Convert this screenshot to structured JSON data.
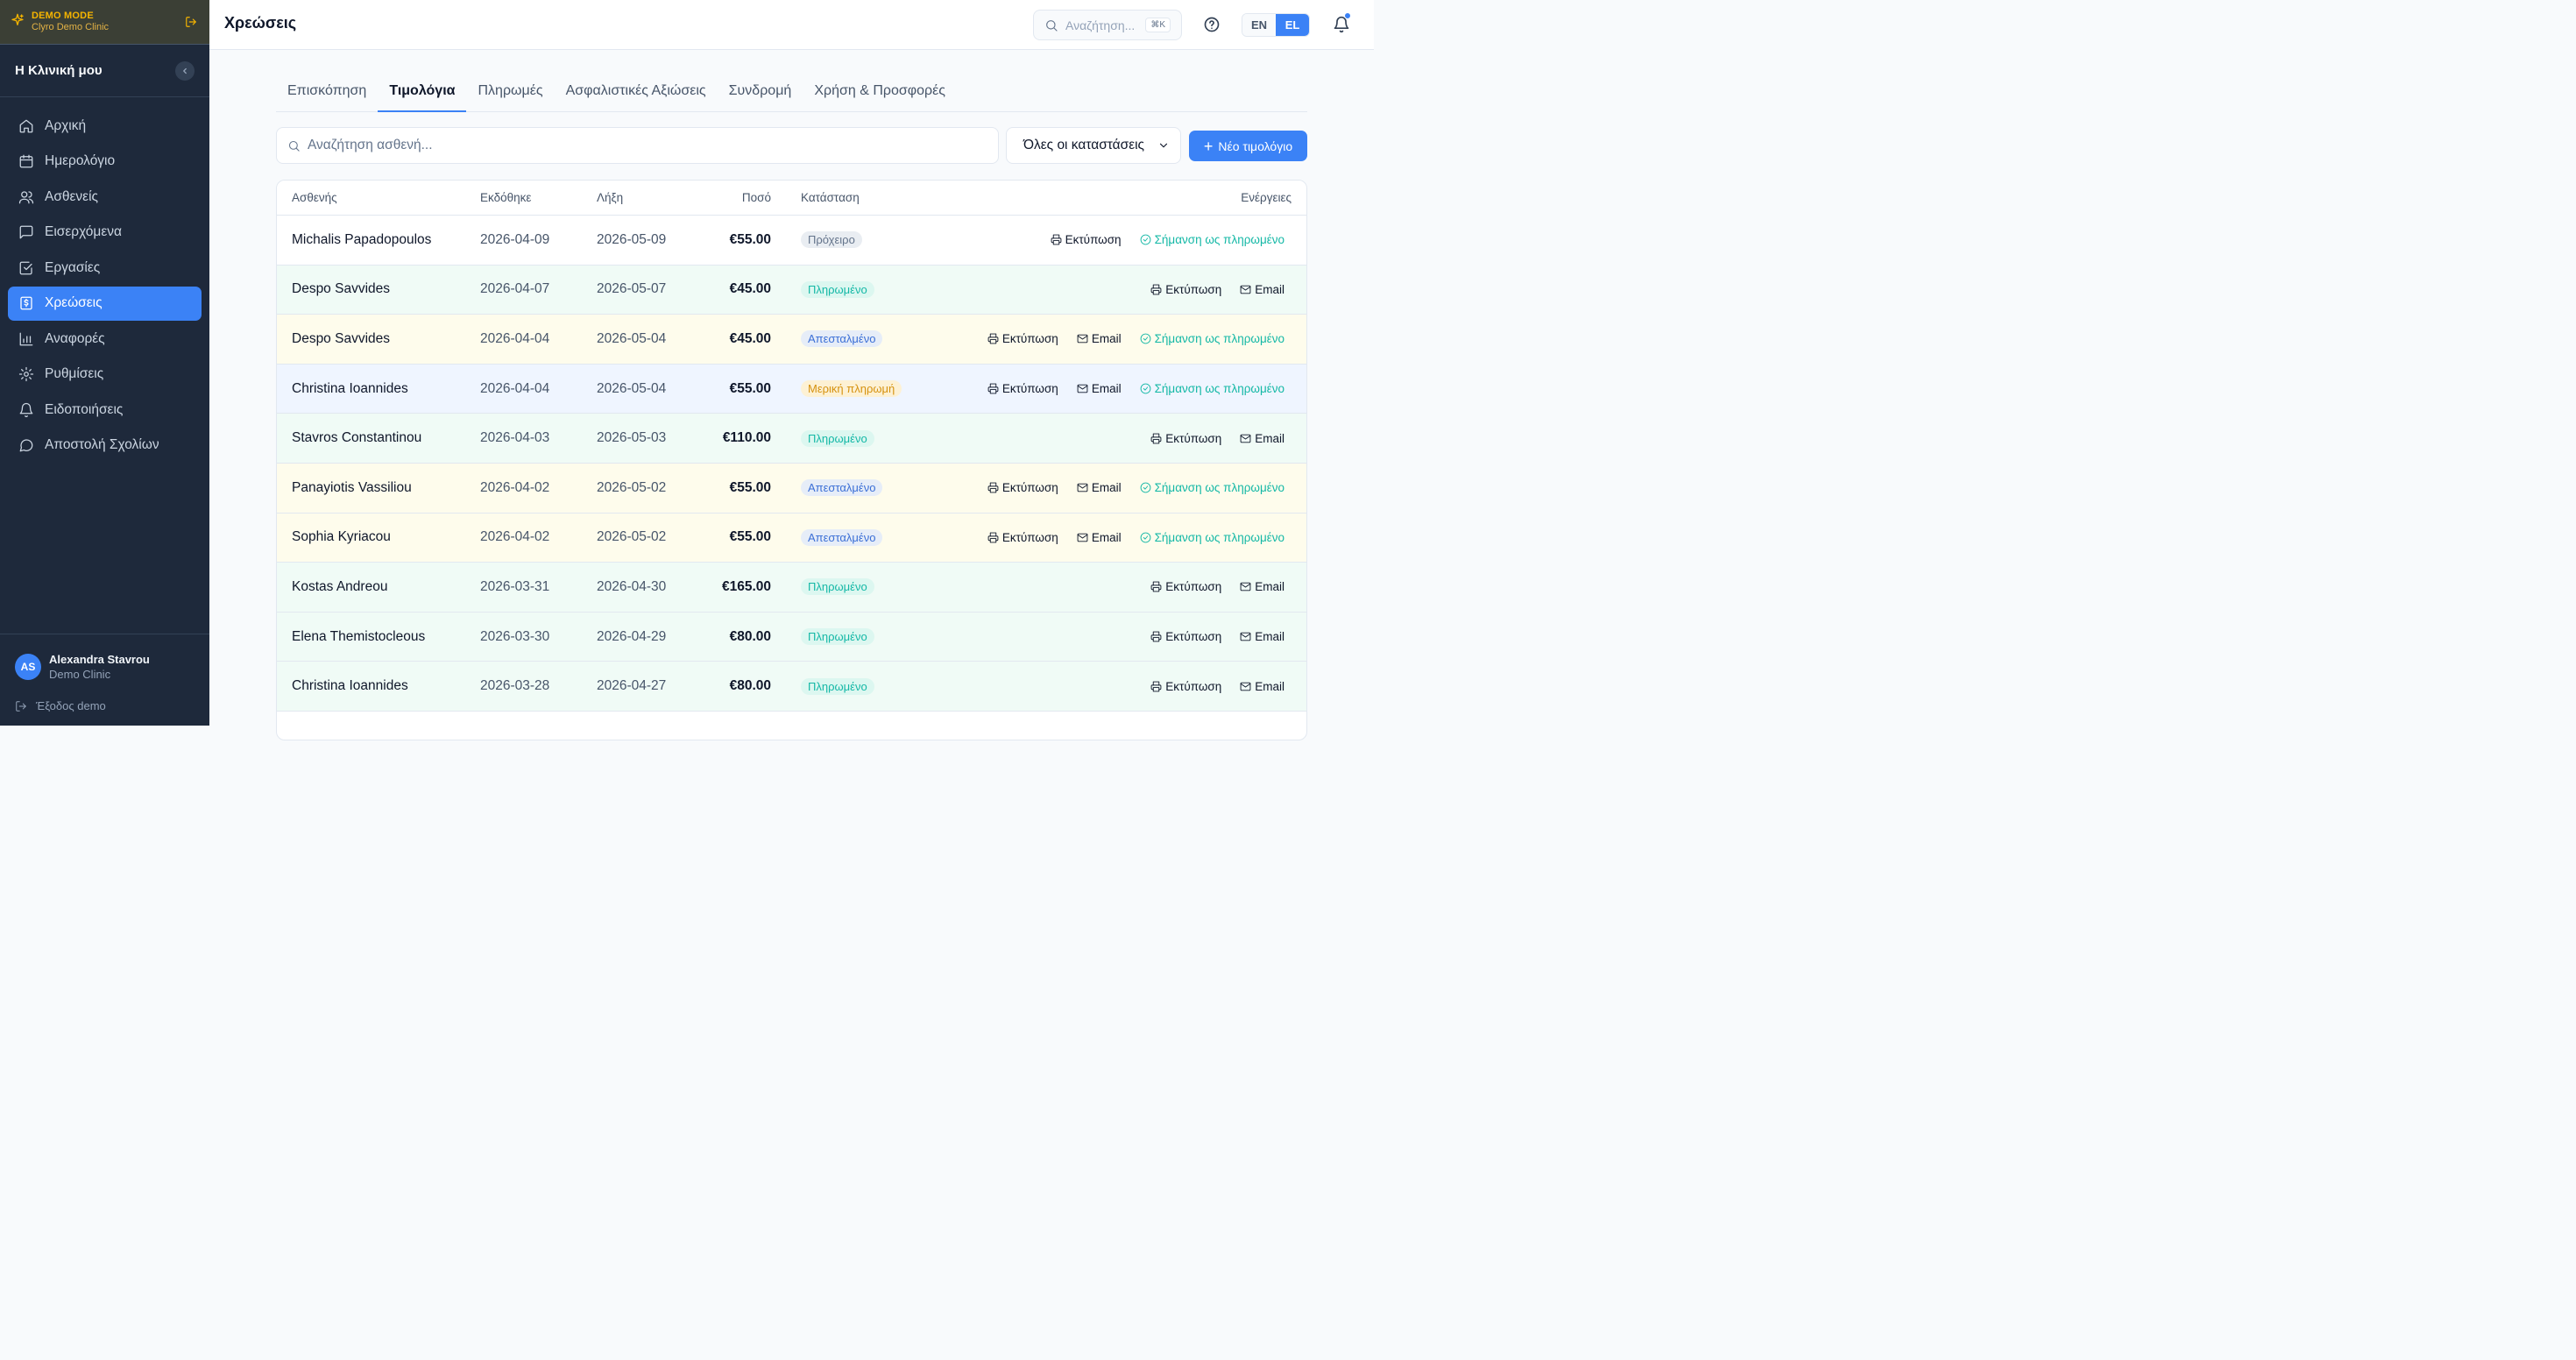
{
  "demo": {
    "mode_label": "DEMO MODE",
    "clinic": "Clyro Demo Clinic"
  },
  "sidebar": {
    "clinic_name": "Η Κλινική μου",
    "items": [
      {
        "label": "Αρχική",
        "icon": "home-icon"
      },
      {
        "label": "Ημερολόγιο",
        "icon": "calendar-icon"
      },
      {
        "label": "Ασθενείς",
        "icon": "users-icon"
      },
      {
        "label": "Εισερχόμενα",
        "icon": "inbox-icon"
      },
      {
        "label": "Εργασίες",
        "icon": "tasks-icon"
      },
      {
        "label": "Χρεώσεις",
        "icon": "billing-icon",
        "active": true
      },
      {
        "label": "Αναφορές",
        "icon": "chart-icon"
      },
      {
        "label": "Ρυθμίσεις",
        "icon": "gear-icon"
      },
      {
        "label": "Ειδοποιήσεις",
        "icon": "bell-icon"
      },
      {
        "label": "Αποστολή Σχολίων",
        "icon": "message-icon"
      }
    ],
    "user": {
      "initials": "AS",
      "name": "Alexandra Stavrou",
      "clinic": "Demo Clinic"
    },
    "logout_label": "Έξοδος demo"
  },
  "header": {
    "title": "Χρεώσεις",
    "search_placeholder": "Αναζήτηση...",
    "shortcut": "⌘K",
    "lang_en": "EN",
    "lang_el": "EL",
    "active_lang": "EL"
  },
  "tabs": [
    "Επισκόπηση",
    "Τιμολόγια",
    "Πληρωμές",
    "Ασφαλιστικές Αξιώσεις",
    "Συνδρομή",
    "Χρήση & Προσφορές"
  ],
  "active_tab": "Τιμολόγια",
  "toolbar": {
    "search_placeholder": "Αναζήτηση ασθενή...",
    "status_filter": "Όλες οι καταστάσεις",
    "new_invoice": "Νέο τιμολόγιο"
  },
  "table": {
    "columns": {
      "patient": "Ασθενής",
      "issued": "Εκδόθηκε",
      "due": "Λήξη",
      "amount": "Ποσό",
      "status": "Κατάσταση",
      "actions": "Ενέργειες"
    },
    "action_labels": {
      "print": "Εκτύπωση",
      "email": "Email",
      "mark_paid": "Σήμανση ως πληρωμένο"
    },
    "rows": [
      {
        "patient": "Michalis Papadopoulos",
        "issued": "2026-04-09",
        "due": "2026-05-09",
        "amount": "€55.00",
        "status": "Πρόχειρο",
        "kind": "draft",
        "actions": [
          "print",
          "mark_paid"
        ]
      },
      {
        "patient": "Despo Savvides",
        "issued": "2026-04-07",
        "due": "2026-05-07",
        "amount": "€45.00",
        "status": "Πληρωμένο",
        "kind": "paid",
        "actions": [
          "print",
          "email"
        ]
      },
      {
        "patient": "Despo Savvides",
        "issued": "2026-04-04",
        "due": "2026-05-04",
        "amount": "€45.00",
        "status": "Απεσταλμένο",
        "kind": "sent",
        "actions": [
          "print",
          "email",
          "mark_paid"
        ]
      },
      {
        "patient": "Christina Ioannides",
        "issued": "2026-04-04",
        "due": "2026-05-04",
        "amount": "€55.00",
        "status": "Μερική πληρωμή",
        "kind": "partial",
        "actions": [
          "print",
          "email",
          "mark_paid"
        ]
      },
      {
        "patient": "Stavros Constantinou",
        "issued": "2026-04-03",
        "due": "2026-05-03",
        "amount": "€110.00",
        "status": "Πληρωμένο",
        "kind": "paid",
        "actions": [
          "print",
          "email"
        ]
      },
      {
        "patient": "Panayiotis Vassiliou",
        "issued": "2026-04-02",
        "due": "2026-05-02",
        "amount": "€55.00",
        "status": "Απεσταλμένο",
        "kind": "sent",
        "actions": [
          "print",
          "email",
          "mark_paid"
        ]
      },
      {
        "patient": "Sophia Kyriacou",
        "issued": "2026-04-02",
        "due": "2026-05-02",
        "amount": "€55.00",
        "status": "Απεσταλμένο",
        "kind": "sent",
        "actions": [
          "print",
          "email",
          "mark_paid"
        ]
      },
      {
        "patient": "Kostas Andreou",
        "issued": "2026-03-31",
        "due": "2026-04-30",
        "amount": "€165.00",
        "status": "Πληρωμένο",
        "kind": "paid",
        "actions": [
          "print",
          "email"
        ]
      },
      {
        "patient": "Elena Themistocleous",
        "issued": "2026-03-30",
        "due": "2026-04-29",
        "amount": "€80.00",
        "status": "Πληρωμένο",
        "kind": "paid",
        "actions": [
          "print",
          "email"
        ]
      },
      {
        "patient": "Christina Ioannides",
        "issued": "2026-03-28",
        "due": "2026-04-27",
        "amount": "€80.00",
        "status": "Πληρωμένο",
        "kind": "paid",
        "actions": [
          "print",
          "email"
        ]
      }
    ]
  },
  "colors": {
    "accent": "#3b82f6",
    "sidebar_bg": "#1e293b",
    "paid_row_bg": "#f0fbf6",
    "sent_row_bg": "#fefcec",
    "partial_row_bg": "#eff5ff",
    "paid_badge_bg": "#dcf7f0",
    "paid_badge_text": "#14b8a6",
    "sent_badge_bg": "#e6edf8",
    "sent_badge_text": "#3b6fd6",
    "partial_badge_bg": "#fdf1d4",
    "partial_badge_text": "#d69210",
    "draft_badge_bg": "#e9edf2",
    "draft_badge_text": "#64748b"
  }
}
